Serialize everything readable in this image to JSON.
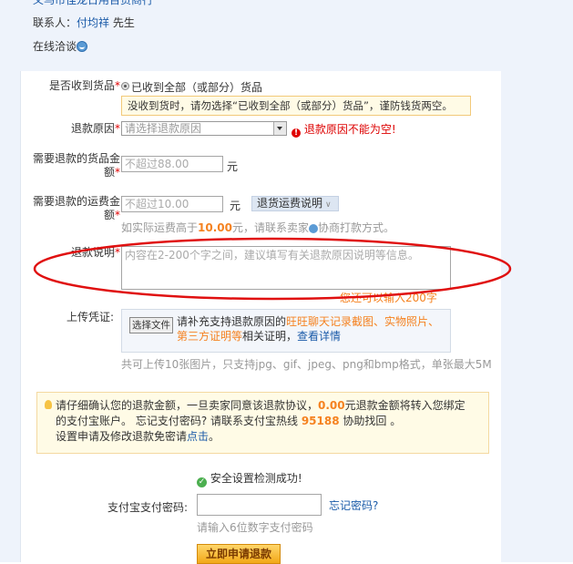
{
  "header": {
    "cutoff_text": "义乌市佳龙日用百货商行",
    "contact_label": "联系人：",
    "contact_name": "付均祥",
    "contact_title": "先生",
    "chat_label": "在线洽谈"
  },
  "form": {
    "received": {
      "label": "是否收到货品",
      "required": "*",
      "option": "已收到全部（或部分）货品",
      "warning": "没收到货时，请勿选择“已收到全部（或部分）货品”，谨防钱货两空。"
    },
    "reason": {
      "label": "退款原因",
      "required": "*",
      "placeholder": "请选择退款原因",
      "error": "退款原因不能为空!"
    },
    "goods_amount": {
      "label_line1": "需要退款的货品金",
      "label_line2": "额",
      "required": "*",
      "placeholder": "不超过88.00",
      "unit": "元"
    },
    "shipping_amount": {
      "label_line1": "需要退款的运费金",
      "label_line2": "额",
      "required": "*",
      "placeholder": "不超过10.00",
      "unit": "元",
      "dropdown": "退货运费说明",
      "hint_prefix": "如实际运费高于",
      "hint_amount": "10.00",
      "hint_suffix": "元，请联系卖家",
      "hint_end": "协商打款方式。"
    },
    "description": {
      "label": "退款说明",
      "required": "*",
      "placeholder": "内容在2-200个字之间，建议填写有关退款原因说明等信息。",
      "remaining": "您还可以输入200字"
    },
    "upload": {
      "label": "上传凭证:",
      "button": "选择文件",
      "text_prefix": "请补充支持退款原因的",
      "text_highlight": "旺旺聊天记录截图、实物照片、第三方证明等",
      "text_mid": "相关证明，",
      "details_link": "查看详情",
      "note": "共可上传10张图片，只支持jpg、gif、jpeg、png和bmp格式，单张最大5M"
    }
  },
  "notice": {
    "line1_a": "请仔细确认您的退款金额，一旦卖家同意该退款协议，",
    "line1_amount": "0.00",
    "line1_b": "元退款金额将转入您绑定",
    "line2_a": "的支付宝账户。 忘记支付密码? 请联系支付宝热线",
    "line2_phone": "95188",
    "line2_b": "协助找回 。",
    "line3_a": "设置申请及修改退款免密请",
    "line3_link": "点击",
    "line3_b": "。"
  },
  "security": {
    "ok_text": "安全设置检测成功!",
    "pay_label": "支付宝支付密码:",
    "forgot_link": "忘记密码?",
    "pay_hint": "请输入6位数字支付密码",
    "submit": "立即申请退款"
  },
  "colors": {
    "panel_bg": "#eef3fb",
    "link": "#1a5aa8",
    "orange": "#f58220",
    "error": "#d00000",
    "annotation": "#e01010"
  }
}
